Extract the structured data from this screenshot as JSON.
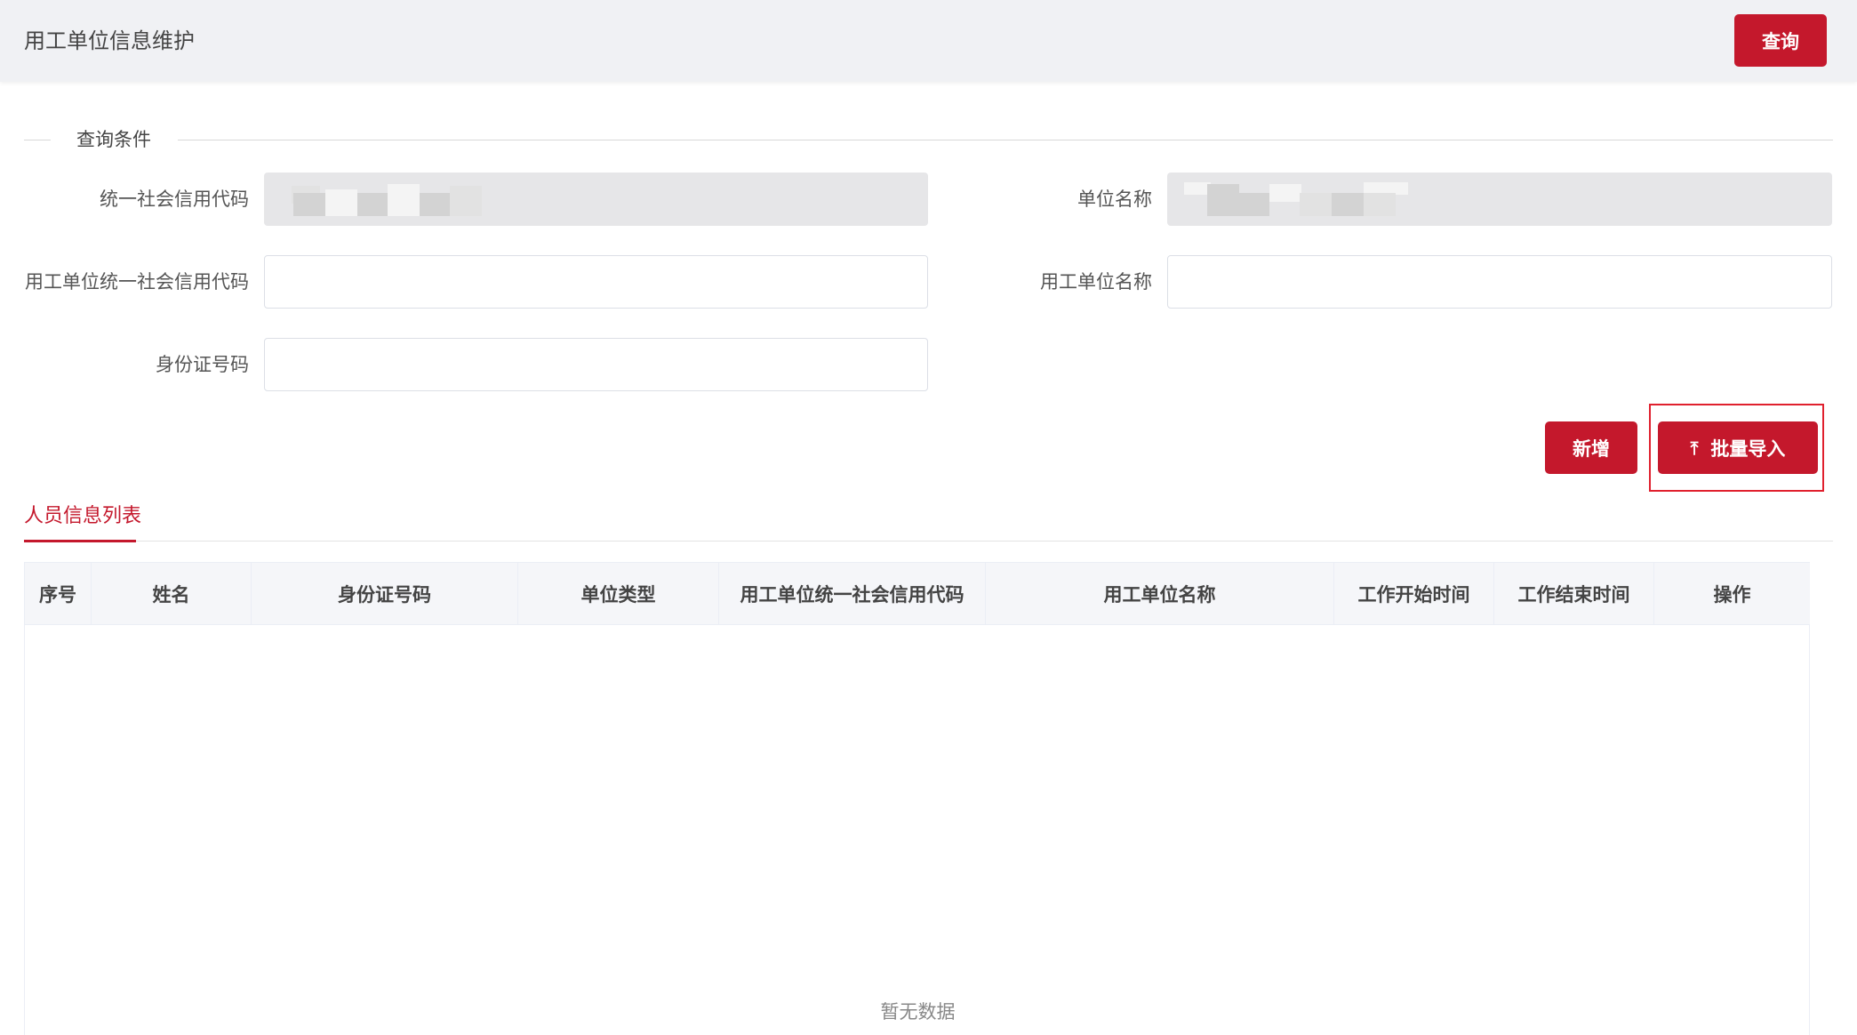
{
  "header": {
    "title": "用工单位信息维护",
    "query_button": "查询"
  },
  "query_section": {
    "legend": "查询条件",
    "fields": {
      "credit_code_label": "统一社会信用代码",
      "credit_code_value": "",
      "unit_name_label": "单位名称",
      "unit_name_value": "",
      "employer_credit_code_label": "用工单位统一社会信用代码",
      "employer_credit_code_value": "",
      "employer_name_label": "用工单位名称",
      "employer_name_value": "",
      "id_number_label": "身份证号码",
      "id_number_value": ""
    }
  },
  "actions": {
    "add_button": "新增",
    "import_button": "批量导入",
    "import_icon": "upload-icon"
  },
  "tab": {
    "label": "人员信息列表"
  },
  "table": {
    "columns": [
      "序号",
      "姓名",
      "身份证号码",
      "单位类型",
      "用工单位统一社会信用代码",
      "用工单位名称",
      "工作开始时间",
      "工作结束时间",
      "操作"
    ],
    "rows": [],
    "empty_text": "暂无数据"
  },
  "colors": {
    "accent": "#c4182c",
    "highlight": "#e0202e",
    "header_bg": "#f0f1f4",
    "table_head_bg": "#f5f6f9"
  }
}
